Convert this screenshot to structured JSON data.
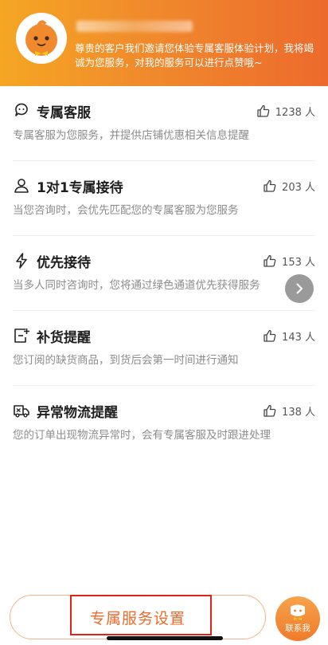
{
  "header": {
    "description": "尊贵的客户我们邀请您体验专属客服体验计划，我将竭诚为您服务，对我的服务可以进行点赞哦~"
  },
  "services": [
    {
      "title": "专属客服",
      "likes": "1238 人",
      "desc": "专属客服为您服务，并提供店铺优惠相关信息提醒",
      "icon": "customer-service-chat-icon"
    },
    {
      "title": "1对1专属接待",
      "likes": "203 人",
      "desc": "当您咨询时，会优先匹配您的专属客服为您服务",
      "icon": "person-icon"
    },
    {
      "title": "优先接待",
      "likes": "153 人",
      "desc": "当多人同时咨询时，您将通过绿色通道优先获得服务",
      "icon": "lightning-icon"
    },
    {
      "title": "补货提醒",
      "likes": "143 人",
      "desc": "您订阅的缺货商品，到货后会第一时间进行通知",
      "icon": "restock-box-icon"
    },
    {
      "title": "异常物流提醒",
      "likes": "138 人",
      "desc": "您的订单出现物流异常时，会有专属客服及时跟进处理",
      "icon": "delivery-truck-icon"
    }
  ],
  "bottom": {
    "settings_label": "专属服务设置",
    "contact_label": "联系我"
  },
  "colors": {
    "accent": "#ee6a2a",
    "header_start": "#f5a623",
    "header_end": "#ec6a2c",
    "highlight": "#e0201a"
  }
}
